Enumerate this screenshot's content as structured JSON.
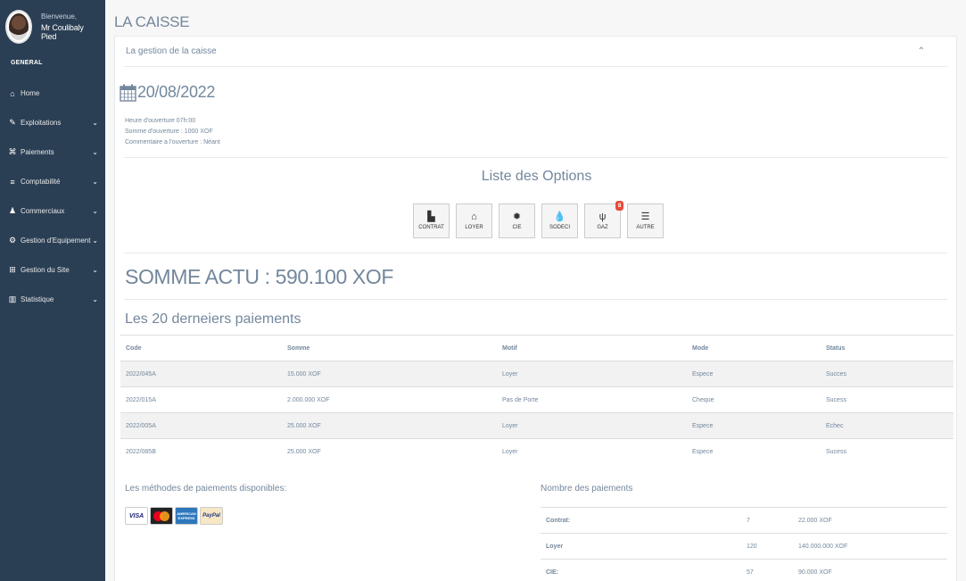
{
  "profile": {
    "welcome": "Bienvenue,",
    "name": "Mr Coulibaly Pied"
  },
  "sidebar": {
    "section": "GENERAL",
    "items": [
      {
        "label": "Home",
        "icon": "home-icon",
        "glyph": "⌂",
        "has_chevron": false
      },
      {
        "label": "Exploitations",
        "icon": "edit-icon",
        "glyph": "✎",
        "has_chevron": true
      },
      {
        "label": "Paiements",
        "icon": "bank-icon",
        "glyph": "⌘",
        "has_chevron": true
      },
      {
        "label": "Comptabilité",
        "icon": "database-icon",
        "glyph": "≡",
        "has_chevron": true
      },
      {
        "label": "Commerciaux",
        "icon": "person-icon",
        "glyph": "♟",
        "has_chevron": true
      },
      {
        "label": "Gestion d'Equipement",
        "icon": "cogs-icon",
        "glyph": "⚙",
        "has_chevron": true
      },
      {
        "label": "Gestion du Site",
        "icon": "sitemap-icon",
        "glyph": "⊞",
        "has_chevron": true
      },
      {
        "label": "Statistique",
        "icon": "bar-chart-icon",
        "glyph": "▥",
        "has_chevron": true
      }
    ]
  },
  "page": {
    "title": "LA CAISSE"
  },
  "panel": {
    "title": "La gestion de la caisse",
    "collapse_glyph": "⌃",
    "date": "20/08/2022",
    "info": {
      "heure": "Heure d'ouverture 07h:00",
      "somme": "Somme d'ouverture : 1000 XOF",
      "commentaire": "Commentaire a l'ouverture : Néant"
    },
    "options_title": "Liste des Options",
    "options": [
      {
        "label": "CONTRAT",
        "icon": "file-icon",
        "glyph": "▙",
        "badge": ""
      },
      {
        "label": "LOYER",
        "icon": "home-icon",
        "glyph": "⌂",
        "badge": ""
      },
      {
        "label": "CIE",
        "icon": "bulb-icon",
        "glyph": "✹",
        "badge": ""
      },
      {
        "label": "SODECI",
        "icon": "water-drop-icon",
        "glyph": "💧",
        "badge": ""
      },
      {
        "label": "GAZ",
        "icon": "cutlery-icon",
        "glyph": "ψ",
        "badge": "8"
      },
      {
        "label": "AUTRE",
        "icon": "server-icon",
        "glyph": "☰",
        "badge": ""
      }
    ],
    "somme_actu": "SOMME ACTU : 590.100 XOF",
    "recent_title": "Les 20 derneiers paiements",
    "table": {
      "headers": [
        "Code",
        "Somme",
        "Motif",
        "Mode",
        "Status"
      ],
      "rows": [
        [
          "2022/045A",
          "15.000 XOF",
          "Loyer",
          "Espece",
          "Succes"
        ],
        [
          "2022/015A",
          "2.000.000 XOF",
          "Pas de Porte",
          "Cheque",
          "Sucess"
        ],
        [
          "2022/005A",
          "25.000 XOF",
          "Loyer",
          "Espece",
          "Echec"
        ],
        [
          "2022/085B",
          "25.000 XOF",
          "Loyer",
          "Espece",
          "Sucess"
        ]
      ]
    },
    "methods_title": "Les méthodes de paiements disponibles:",
    "cards": {
      "visa": "VISA",
      "amex": "AMERICAN EXPRESS",
      "paypal": "PayPal"
    },
    "count_title": "Nombre des paiements",
    "counts": [
      [
        "Contrat:",
        "7",
        "22.000 XOF"
      ],
      [
        "Loyer",
        "120",
        "140.000.000 XOF"
      ],
      [
        "CIE:",
        "57",
        "90.000 XOF"
      ]
    ]
  },
  "colors": {
    "sidebar_bg": "#2a3f54",
    "badge": "#e74c3c",
    "text": "#73879c"
  }
}
